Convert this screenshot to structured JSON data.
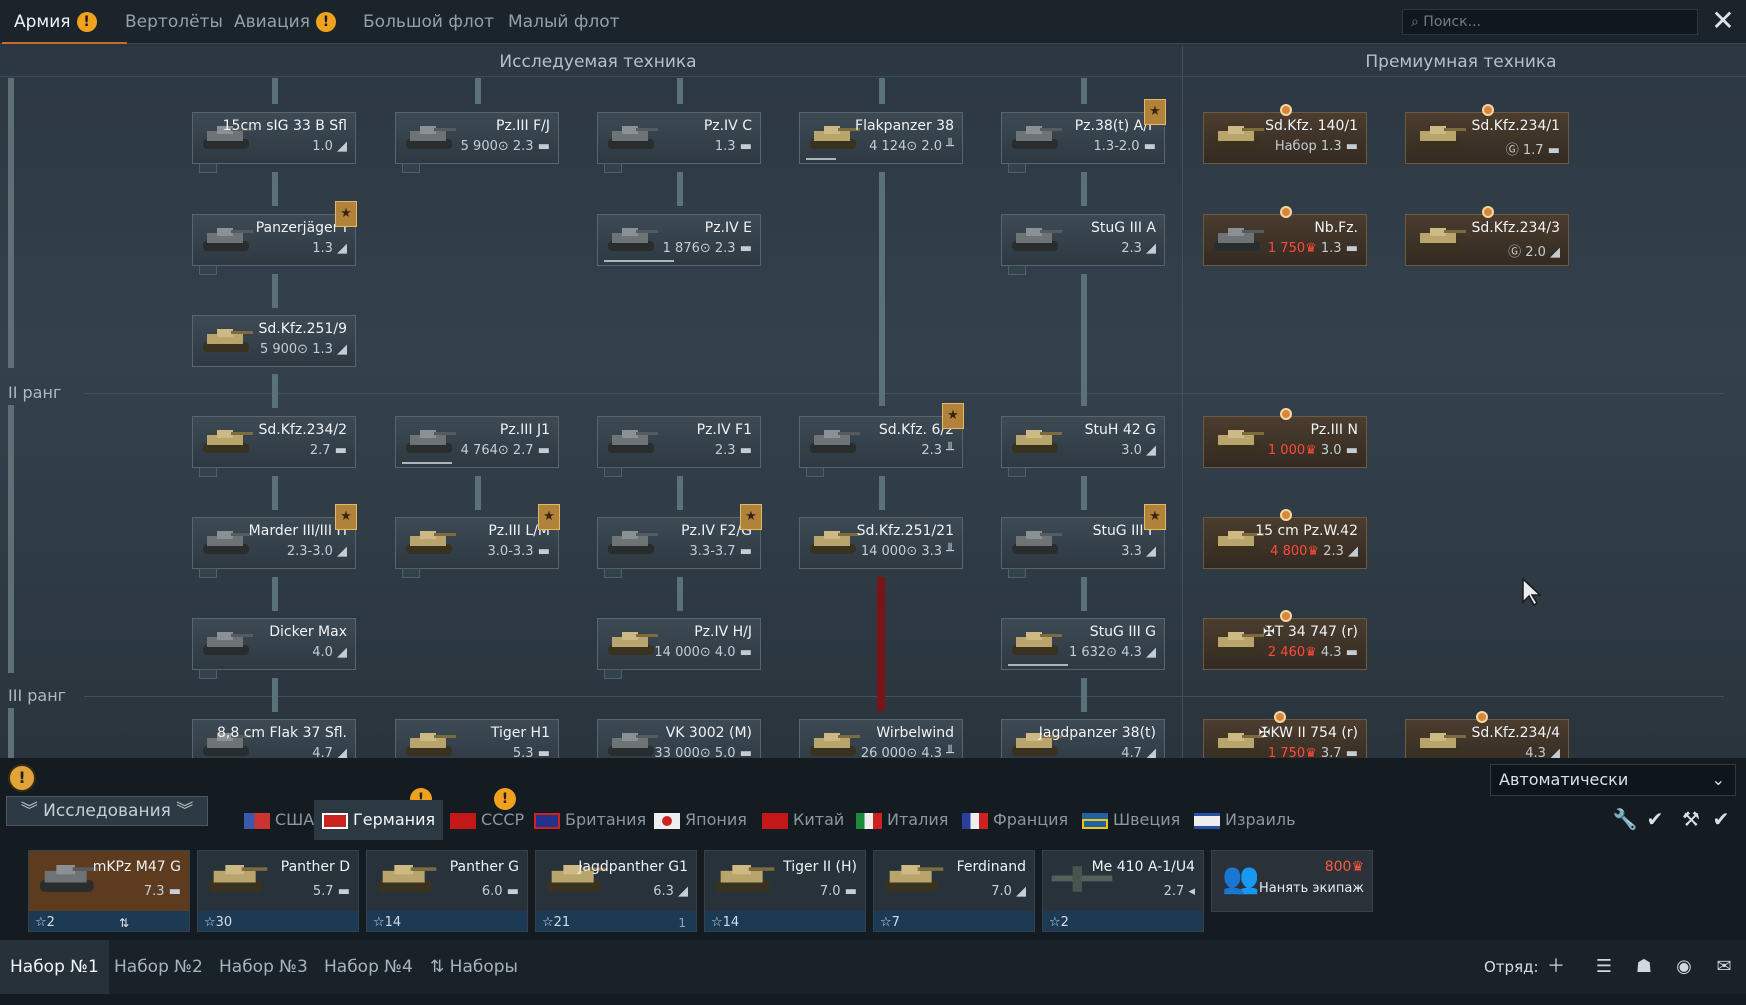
{
  "top_tabs": [
    {
      "label": "Армия",
      "warn": true,
      "active": true
    },
    {
      "label": "Вертолёты"
    },
    {
      "label": "Авиация",
      "warn": true
    },
    {
      "label": "Большой флот"
    },
    {
      "label": "Малый флот"
    }
  ],
  "search_placeholder": "Поиск...",
  "columns": {
    "researched": "Исследуемая техника",
    "premium": "Премиумная техника"
  },
  "ranks": {
    "r2": "II ранг",
    "r3": "III ранг"
  },
  "vehicles": [
    {
      "name": "15cm sIG 33 B Sfl",
      "stat": "1.0 ◢"
    },
    {
      "name": "Pz.III F/J",
      "stat": "5 900⊙ 2.3 ▬"
    },
    {
      "name": "Pz.IV C",
      "stat": "1.3 ▬"
    },
    {
      "name": "Flakpanzer 38",
      "stat": "4 124⊙ 2.0 ╨"
    },
    {
      "name": "Pz.38(t) A/F",
      "stat": "1.3-2.0 ▬"
    },
    {
      "name": "Panzerjäger I",
      "stat": "1.3 ◢"
    },
    {
      "name": "Pz.IV E",
      "stat": "1 876⊙ 2.3 ▬"
    },
    {
      "name": "StuG III A",
      "stat": "2.3 ◢"
    },
    {
      "name": "Sd.Kfz.251/9",
      "stat": "5 900⊙ 1.3 ◢"
    },
    {
      "name": "Sd.Kfz.234/2",
      "stat": "2.7 ▬"
    },
    {
      "name": "Pz.III J1",
      "stat": "4 764⊙ 2.7 ▬"
    },
    {
      "name": "Pz.IV F1",
      "stat": "2.3 ▬"
    },
    {
      "name": "Sd.Kfz. 6/2",
      "stat": "2.3 ╨"
    },
    {
      "name": "StuH 42 G",
      "stat": "3.0 ◢"
    },
    {
      "name": "Marder III/III H",
      "stat": "2.3-3.0 ◢"
    },
    {
      "name": "Pz.III L/M",
      "stat": "3.0-3.3 ▬"
    },
    {
      "name": "Pz.IV F2/G",
      "stat": "3.3-3.7 ▬"
    },
    {
      "name": "Sd.Kfz.251/21",
      "stat": "14 000⊙ 3.3 ╨"
    },
    {
      "name": "StuG III F",
      "stat": "3.3 ◢"
    },
    {
      "name": "Dicker Max",
      "stat": "4.0 ◢"
    },
    {
      "name": "Pz.IV H/J",
      "stat": "14 000⊙ 4.0 ▬"
    },
    {
      "name": "StuG III G",
      "stat": "1 632⊙ 4.3 ◢"
    },
    {
      "name": "8,8 cm Flak 37 Sfl.",
      "stat": "4.7 ◢"
    },
    {
      "name": "Tiger H1",
      "stat": "5.3 ▬"
    },
    {
      "name": "VK 3002 (M)",
      "stat": "33 000⊙ 5.0 ▬"
    },
    {
      "name": "Wirbelwind",
      "stat": "26 000⊙ 4.3 ╨"
    },
    {
      "name": "Jagdpanzer 38(t)",
      "stat": "4.7 ◢"
    }
  ],
  "premium": [
    {
      "name": "Sd.Kfz. 140/1",
      "stat": "Набор 1.3 ▬"
    },
    {
      "name": "Sd.Kfz.234/1",
      "stat": "Ⓖ 1.7 ▬"
    },
    {
      "name": "Nb.Fz.",
      "price": "1 750♛",
      "stat": "1.3 ▬"
    },
    {
      "name": "Sd.Kfz.234/3",
      "stat": "Ⓖ 2.0 ◢"
    },
    {
      "name": "Pz.III N",
      "price": "1 000♛",
      "stat": "3.0 ▬"
    },
    {
      "name": "15 cm Pz.W.42",
      "price": "4 800♛",
      "stat": "2.3 ◢"
    },
    {
      "name": "✠T 34 747 (r)",
      "price": "2 460♛",
      "stat": "4.3 ▬"
    },
    {
      "name": "✠KW II 754 (r)",
      "price": "1 750♛",
      "stat": "3.7 ▬"
    },
    {
      "name": "Sd.Kfz.234/4",
      "stat": "4.3 ◢"
    }
  ],
  "mode_select": "Автоматически",
  "research_label": "Исследования",
  "nations": [
    "США",
    "Германия",
    "СССР",
    "Британия",
    "Япония",
    "Китай",
    "Италия",
    "Франция",
    "Швеция",
    "Израиль"
  ],
  "crew_slots": [
    {
      "name": "mKPz M47 G",
      "stat": "7.3 ▬",
      "crew": "☆2"
    },
    {
      "name": "Panther D",
      "stat": "5.7 ▬",
      "crew": "☆30"
    },
    {
      "name": "Panther G",
      "stat": "6.0 ▬",
      "crew": "☆14"
    },
    {
      "name": "Jagdpanther G1",
      "stat": "6.3 ◢",
      "crew": "☆21",
      "sub": "1"
    },
    {
      "name": "Tiger II (H)",
      "stat": "7.0 ▬",
      "crew": "☆14"
    },
    {
      "name": "Ferdinand",
      "stat": "7.0 ◢",
      "crew": "☆7"
    },
    {
      "name": "Me 410 A-1/U4",
      "stat": "2.7 ◂",
      "crew": "☆2"
    }
  ],
  "hire": {
    "price": "800♛",
    "label": "Нанять экипаж"
  },
  "presets": [
    "Набор №1",
    "Набор №2",
    "Набор №3",
    "Набор №4",
    "Наборы"
  ],
  "squad_label": "Отряд:"
}
